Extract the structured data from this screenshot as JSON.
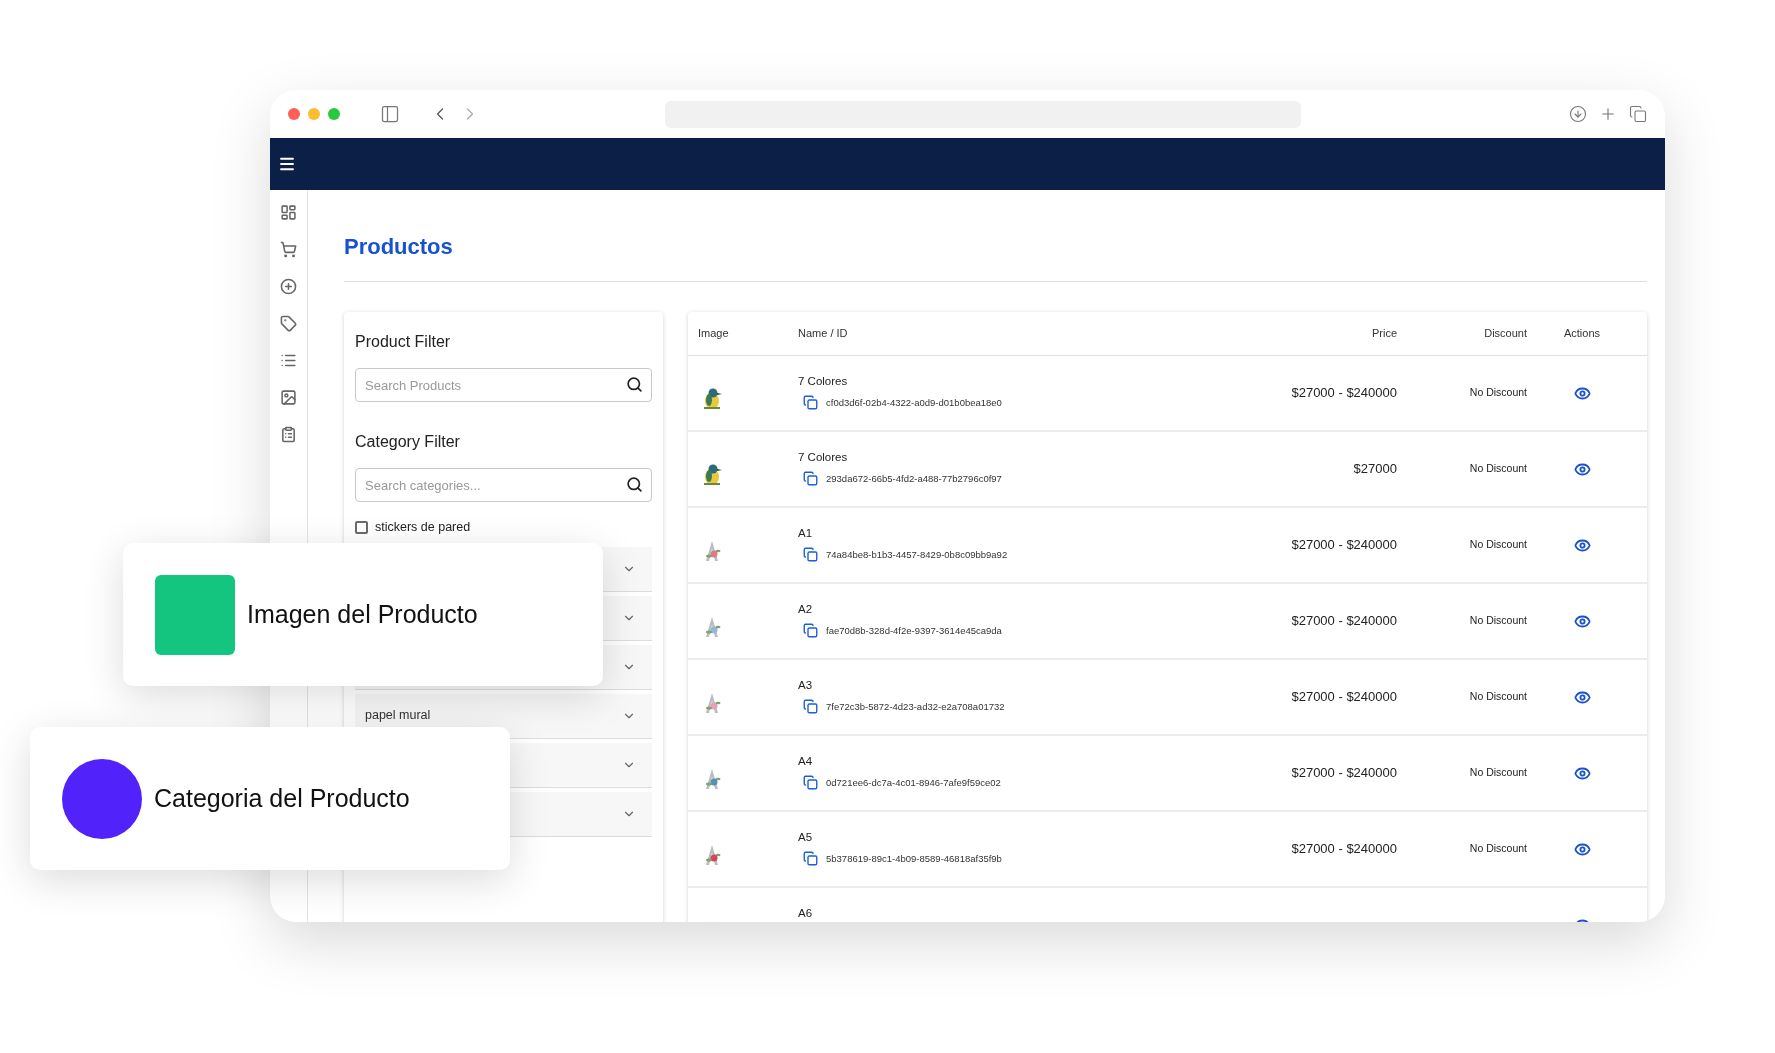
{
  "page_title": "Productos",
  "product_filter": {
    "title": "Product Filter",
    "placeholder": "Search Products"
  },
  "category_filter": {
    "title": "Category Filter",
    "placeholder": "Search categories..."
  },
  "categories": [
    {
      "label": "stickers de pared",
      "checked": false
    }
  ],
  "category_groups": [
    {
      "expanded": false
    },
    {
      "expanded": false
    },
    {
      "expanded": false
    },
    {
      "label": "papel mural",
      "expanded": false
    },
    {
      "expanded": false
    },
    {
      "expanded": false
    }
  ],
  "table": {
    "columns": [
      "Image",
      "Name / ID",
      "Price",
      "Discount",
      "Actions"
    ],
    "rows": [
      {
        "name": "7 Colores",
        "id": "cf0d3d6f-02b4-4322-a0d9-d01b0bea18e0",
        "price": "$27000 - $240000",
        "discount": "No Discount"
      },
      {
        "name": "7 Colores",
        "id": "293da672-66b5-4fd2-a488-77b2796c0f97",
        "price": "$27000",
        "discount": "No Discount"
      },
      {
        "name": "A1",
        "id": "74a84be8-b1b3-4457-8429-0b8c09bb9a92",
        "price": "$27000 - $240000",
        "discount": "No Discount"
      },
      {
        "name": "A2",
        "id": "fae70d8b-328d-4f2e-9397-3614e45ca9da",
        "price": "$27000 - $240000",
        "discount": "No Discount"
      },
      {
        "name": "A3",
        "id": "7fe72c3b-5872-4d23-ad32-e2a708a01732",
        "price": "$27000 - $240000",
        "discount": "No Discount"
      },
      {
        "name": "A4",
        "id": "0d721ee6-dc7a-4c01-8946-7afe9f59ce02",
        "price": "$27000 - $240000",
        "discount": "No Discount"
      },
      {
        "name": "A5",
        "id": "5b378619-89c1-4b09-8589-46818af35f9b",
        "price": "$27000 - $240000",
        "discount": "No Discount"
      },
      {
        "name": "A6"
      }
    ]
  },
  "callouts": [
    {
      "kind": "square",
      "label": "Imagen del Producto",
      "color": "#13c57e"
    },
    {
      "kind": "circle",
      "label": "Categoria del Producto",
      "color": "#5222fb"
    }
  ]
}
